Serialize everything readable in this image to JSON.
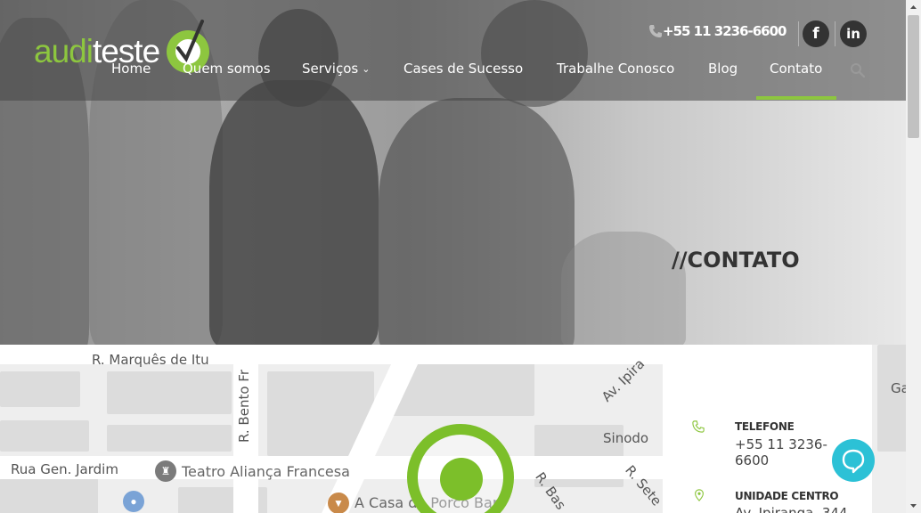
{
  "header": {
    "logo": {
      "part1": "audi",
      "part2": "teste"
    },
    "phone": "+55 11 3236-6600",
    "social": {
      "facebook": "f",
      "linkedin": "in"
    },
    "nav": [
      {
        "label": "Home"
      },
      {
        "label": "Quem somos"
      },
      {
        "label": "Serviços"
      },
      {
        "label": "Cases de Sucesso"
      },
      {
        "label": "Trabalhe Conosco"
      },
      {
        "label": "Blog"
      },
      {
        "label": "Contato"
      }
    ],
    "active_nav": "Contato",
    "accent_color": "#8dc63f"
  },
  "hero": {
    "title": "//CONTATO"
  },
  "map": {
    "streets": [
      "R. Marquês de Itu",
      "R. Bento Fr",
      "Av. Ipira",
      "Rua Gen. Jardim",
      "Sinodo",
      "R. Bas",
      "R. Sete",
      "Ga"
    ],
    "pois": [
      "Teatro Aliança Francesa",
      "A Casa do Porco Bar"
    ],
    "pin_color": "#7cbf2a"
  },
  "contact": {
    "items": [
      {
        "label": "TELEFONE",
        "value": "+55 11 3236-6600",
        "icon": "phone-icon"
      },
      {
        "label": "UNIDADE CENTRO",
        "value": "Av. Ipiranga, 344",
        "icon": "location-pin-icon"
      }
    ]
  },
  "chat": {
    "icon": "chat-bubble-icon",
    "color": "#2cc1d6"
  }
}
